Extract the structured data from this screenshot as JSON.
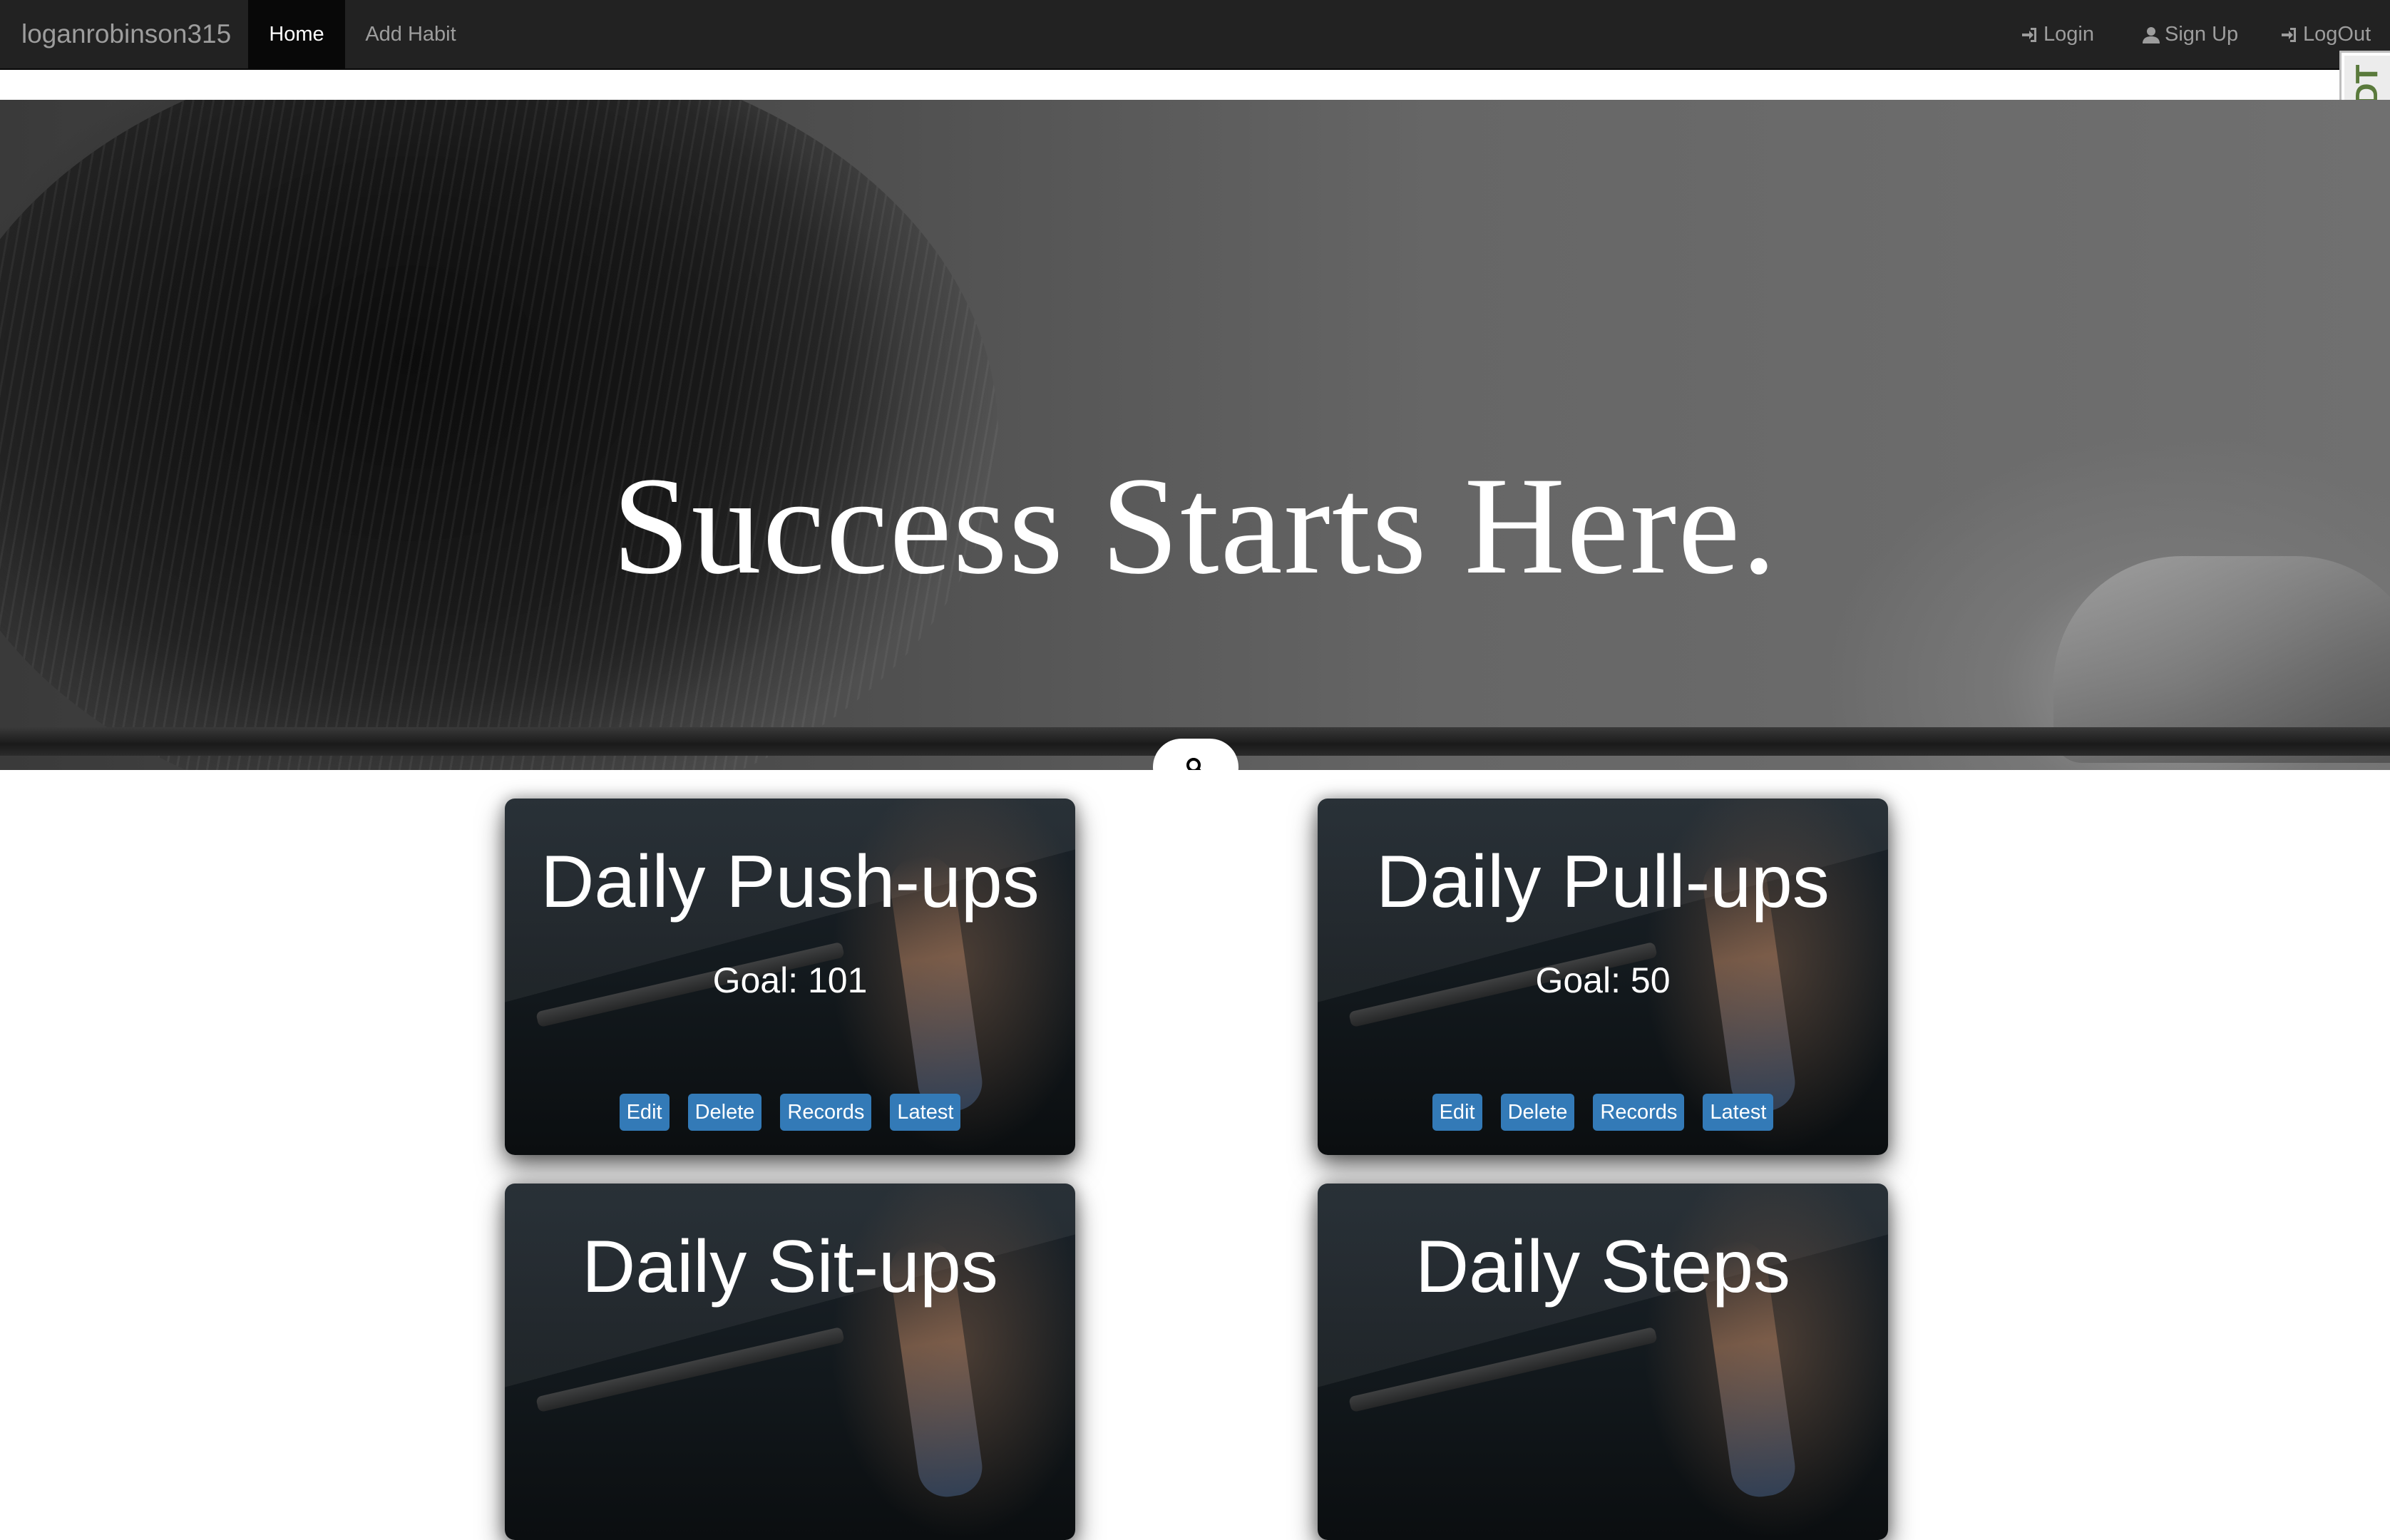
{
  "navbar": {
    "brand": "loganrobinson315",
    "links": [
      {
        "label": "Home",
        "active": true
      },
      {
        "label": "Add Habit"
      }
    ],
    "right": [
      {
        "label": "Login",
        "icon": "login-icon"
      },
      {
        "label": "Sign Up",
        "icon": "user-icon"
      },
      {
        "label": "LogOut",
        "icon": "login-icon"
      }
    ]
  },
  "debug_toolbar": {
    "label": "DJDT"
  },
  "hero": {
    "title": "Success Starts Here.",
    "search_icon": "search-icon"
  },
  "habits": [
    {
      "title": "Daily Push-ups",
      "goal": "Goal: 101",
      "actions": [
        "Edit",
        "Delete",
        "Records",
        "Latest"
      ]
    },
    {
      "title": "Daily Pull-ups",
      "goal": "Goal: 50",
      "actions": [
        "Edit",
        "Delete",
        "Records",
        "Latest"
      ]
    },
    {
      "title": "Daily Sit-ups"
    },
    {
      "title": "Daily Steps"
    }
  ],
  "colors": {
    "navbar_bg": "#222222",
    "nav_active_bg": "#080808",
    "button_primary": "#337ab7",
    "nav_text": "#9d9d9d"
  }
}
